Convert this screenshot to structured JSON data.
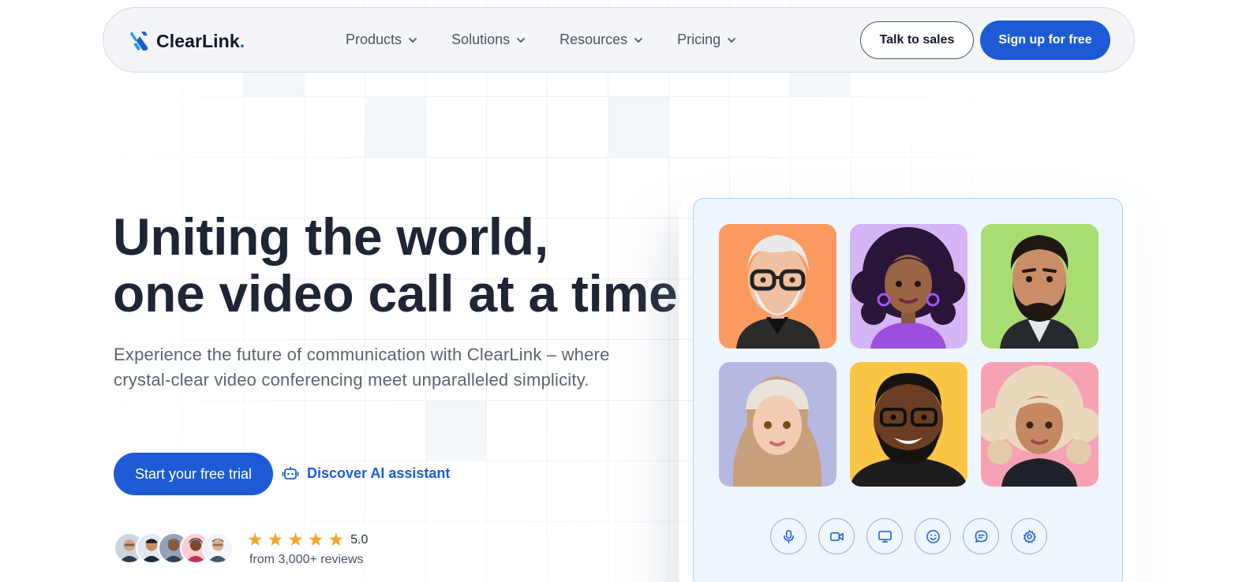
{
  "brand": {
    "name": "ClearLink",
    "dot": ".",
    "accent": "#1d5bd6"
  },
  "nav": {
    "items": [
      {
        "label": "Products"
      },
      {
        "label": "Solutions"
      },
      {
        "label": "Resources"
      },
      {
        "label": "Pricing"
      }
    ],
    "talk_to_sales": "Talk to sales",
    "sign_up": "Sign up for free"
  },
  "hero": {
    "title_line1": "Uniting the world,",
    "title_line2": "one video call at a time",
    "description": "Experience the future of communication with ClearLink – where crystal-clear video conferencing meet unparalleled simplicity.",
    "cta_primary": "Start your free trial",
    "cta_secondary": "Discover AI assistant"
  },
  "social_proof": {
    "rating": "5.0",
    "stars": 5,
    "reviews": "from 3,000+ reviews"
  },
  "call_card": {
    "participants": [
      {
        "name": "older-man-glasses",
        "bg": "#fb9a5f"
      },
      {
        "name": "woman-curly-hair",
        "bg": "#d6b4f5"
      },
      {
        "name": "bearded-man",
        "bg": "#a9dc72"
      },
      {
        "name": "woman-hijab",
        "bg": "#b5b8e0"
      },
      {
        "name": "man-glasses-smiling",
        "bg": "#fbc646"
      },
      {
        "name": "woman-blonde-curls",
        "bg": "#f7a1b5"
      }
    ],
    "controls": [
      "microphone-icon",
      "video-camera-icon",
      "screen-share-icon",
      "emoji-icon",
      "chat-icon",
      "settings-icon"
    ]
  }
}
